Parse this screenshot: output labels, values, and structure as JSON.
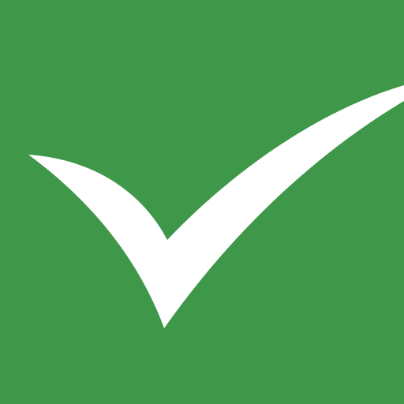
{
  "icon": {
    "name": "checkmark-icon",
    "background_color": "#3f984a",
    "mark_color": "#ffffff"
  }
}
